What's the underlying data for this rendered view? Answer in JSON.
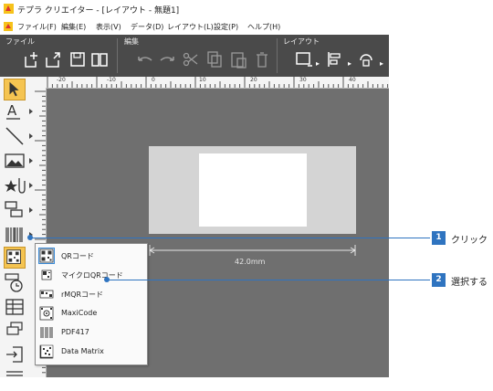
{
  "window": {
    "title": "テプラ クリエイター - [レイアウト - 無題1]"
  },
  "menu": [
    "ファイル(F)",
    "編集(E)",
    "表示(V)",
    "データ(D)",
    "レイアウト(L)",
    "設定(P)",
    "ヘルプ(H)"
  ],
  "ribbon": {
    "groups": [
      "ファイル",
      "編集",
      "レイアウト"
    ]
  },
  "ruler": {
    "h_labels": [
      "-20",
      "-10",
      "0",
      "10",
      "20",
      "30",
      "40"
    ]
  },
  "canvas": {
    "width_label": "42.0mm"
  },
  "dropdown": {
    "items": [
      "QRコード",
      "マイクロQRコード",
      "rMQRコード",
      "MaxiCode",
      "PDF417",
      "Data Matrix"
    ]
  },
  "callouts": [
    {
      "number": "1",
      "text": "クリック"
    },
    {
      "number": "2",
      "text": "選択する"
    }
  ],
  "colors": {
    "accent": "#2f74c0",
    "ribbon": "#4a4a4a",
    "canvas": "#6f6f6f",
    "selected_tool": "#f5c451"
  }
}
